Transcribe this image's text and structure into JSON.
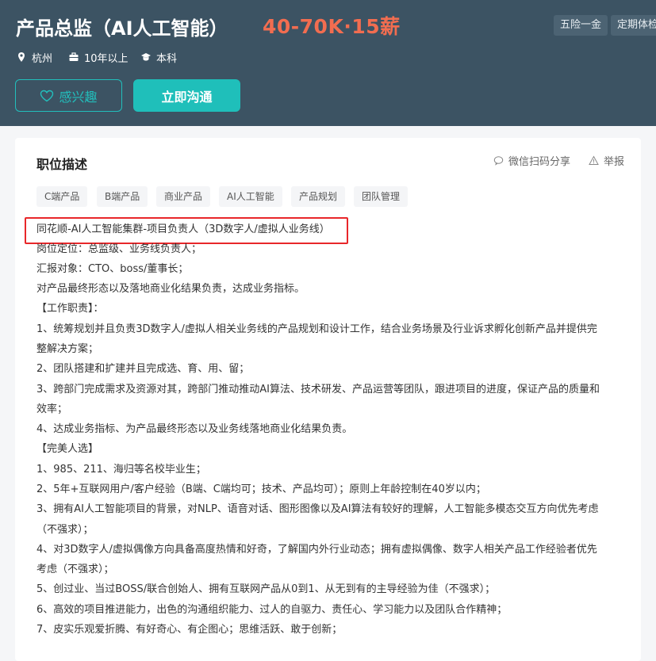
{
  "header": {
    "title": "产品总监（AI人工智能）",
    "salary": "40-70K·15薪",
    "benefits": [
      "五险一金",
      "定期体检"
    ],
    "meta": {
      "city": "杭州",
      "experience": "10年以上",
      "education": "本科"
    },
    "buttons": {
      "interest": "感兴趣",
      "chat": "立即沟通"
    }
  },
  "card": {
    "section_title": "职位描述",
    "share_label": "微信扫码分享",
    "report_label": "举报",
    "tags": [
      "C端产品",
      "B端产品",
      "商业产品",
      "AI人工智能",
      "产品规划",
      "团队管理"
    ],
    "description": [
      "同花顺-AI人工智能集群-项目负责人（3D数字人/虚拟人业务线）",
      "岗位定位：总监级、业务线负责人；",
      "汇报对象：CTO、boss/董事长；",
      "对产品最终形态以及落地商业化结果负责，达成业务指标。",
      "【工作职责】：",
      "1、统筹规划并且负责3D数字人/虚拟人相关业务线的产品规划和设计工作，结合业务场景及行业诉求孵化创新产品并提供完",
      "整解决方案；",
      "2、团队搭建和扩建并且完成选、育、用、留；",
      "3、跨部门完成需求及资源对其，跨部门推动推动AI算法、技术研发、产品运营等团队，跟进项目的进度，保证产品的质量和",
      "效率；",
      "4、达成业务指标、为产品最终形态以及业务线落地商业化结果负责。",
      "【完美人选】",
      "1、985、211、海归等名校毕业生；",
      "2、5年+互联网用户/客户经验（B端、C端均可；技术、产品均可）；原则上年龄控制在40岁以内；",
      "3、拥有AI人工智能项目的背景，对NLP、语音对话、图形图像以及AI算法有较好的理解，人工智能多模态交互方向优先考虑",
      "（不强求）；",
      "4、对3D数字人/虚拟偶像方向具备高度热情和好奇，了解国内外行业动态；拥有虚拟偶像、数字人相关产品工作经验者优先",
      "考虑（不强求）；",
      "5、创过业、当过BOSS/联合创始人、拥有互联网产品从0到1、从无到有的主导经验为佳（不强求）；",
      "6、高效的项目推进能力，出色的沟通组织能力、过人的自驱力、责任心、学习能力以及团队合作精神；",
      "7、皮实乐观爱折腾、有好奇心、有企图心；思维活跃、敢于创新；"
    ]
  },
  "colors": {
    "header_bg": "#3c5363",
    "salary": "#f26d50",
    "accent": "#1fbfba",
    "highlight": "#e8272a"
  }
}
